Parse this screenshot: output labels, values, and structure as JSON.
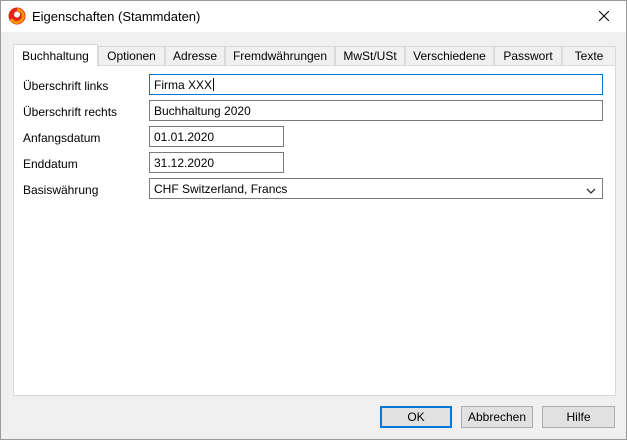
{
  "window": {
    "title": "Eigenschaften (Stammdaten)"
  },
  "tabs": [
    {
      "label": "Buchhaltung",
      "active": true
    },
    {
      "label": "Optionen"
    },
    {
      "label": "Adresse"
    },
    {
      "label": "Fremdwährungen"
    },
    {
      "label": "MwSt/USt"
    },
    {
      "label": "Verschiedene"
    },
    {
      "label": "Passwort"
    },
    {
      "label": "Texte"
    }
  ],
  "form": {
    "header_left": {
      "label": "Überschrift links",
      "value": "Firma XXX"
    },
    "header_right": {
      "label": "Überschrift rechts",
      "value": "Buchhaltung 2020"
    },
    "start_date": {
      "label": "Anfangsdatum",
      "value": "01.01.2020"
    },
    "end_date": {
      "label": "Enddatum",
      "value": "31.12.2020"
    },
    "base_currency": {
      "label": "Basiswährung",
      "value": "CHF Switzerland, Francs"
    }
  },
  "buttons": {
    "ok": "OK",
    "cancel": "Abbrechen",
    "help": "Hilfe"
  },
  "icons": {
    "app": "banana-app-icon",
    "close": "close-icon",
    "dropdown": "chevron-down-icon"
  },
  "colors": {
    "accent": "#0078d7",
    "app_icon_red": "#e2231a",
    "app_icon_orange": "#f39200"
  }
}
